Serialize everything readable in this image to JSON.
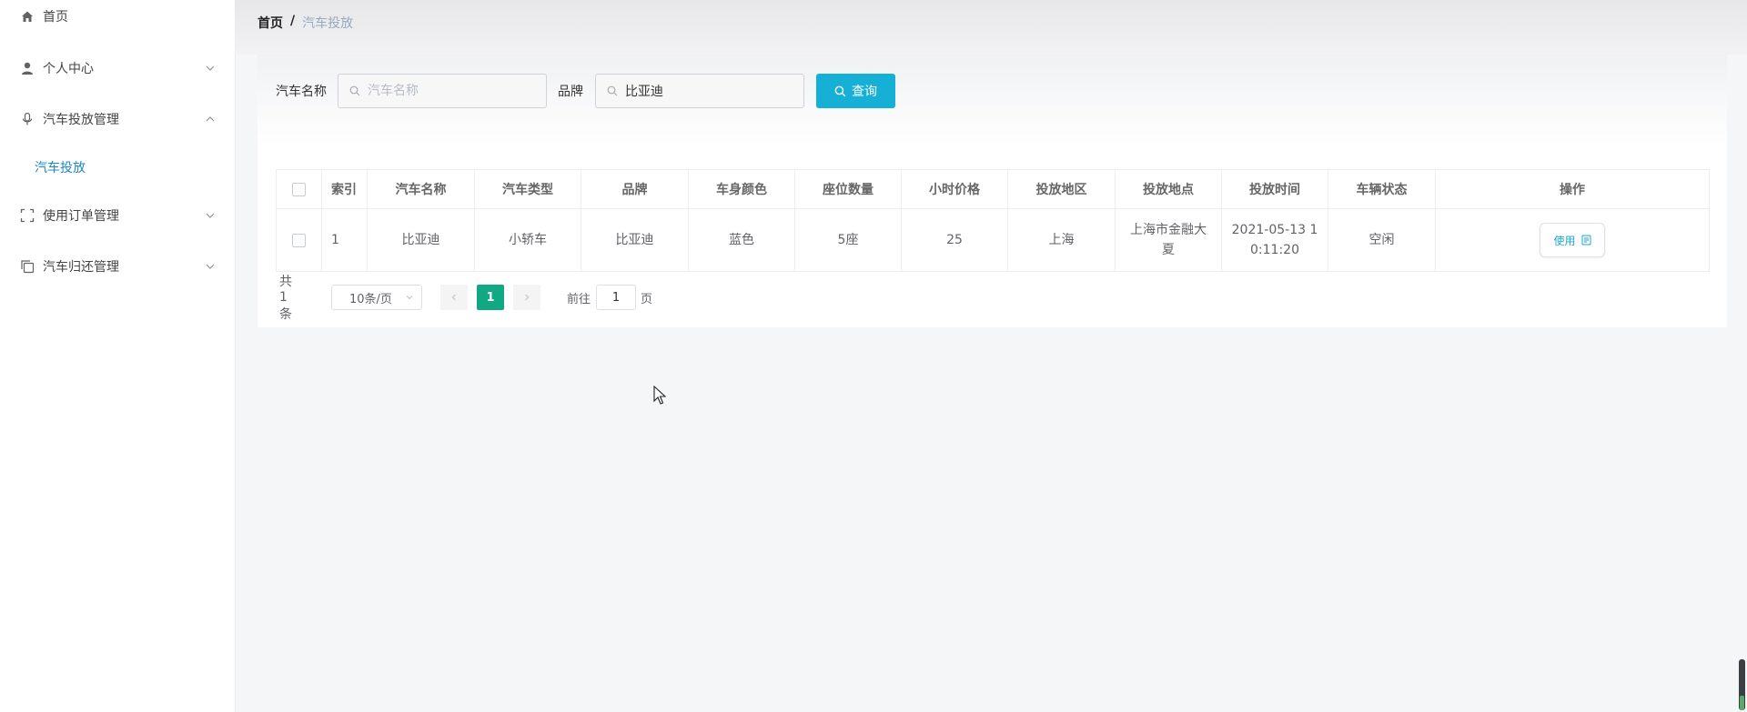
{
  "sidebar": {
    "items": [
      {
        "label": "首页",
        "icon": "home-icon"
      },
      {
        "label": "个人中心",
        "icon": "user-icon"
      },
      {
        "label": "汽车投放管理",
        "icon": "microphone-icon",
        "expanded": true,
        "children": [
          {
            "label": "汽车投放",
            "active": true
          }
        ]
      },
      {
        "label": "使用订单管理",
        "icon": "scan-icon"
      },
      {
        "label": "汽车归还管理",
        "icon": "copy-icon"
      }
    ]
  },
  "breadcrumb": {
    "home": "首页",
    "sep": "/",
    "current": "汽车投放"
  },
  "search": {
    "name_label": "汽车名称",
    "name_placeholder": "汽车名称",
    "name_value": "",
    "brand_label": "品牌",
    "brand_value": "比亚迪",
    "query_label": "查询"
  },
  "table": {
    "headers": [
      "索引",
      "汽车名称",
      "汽车类型",
      "品牌",
      "车身颜色",
      "座位数量",
      "小时价格",
      "投放地区",
      "投放地点",
      "投放时间",
      "车辆状态",
      "操作"
    ],
    "rows": [
      {
        "index": "1",
        "name": "比亚迪",
        "type": "小轿车",
        "brand": "比亚迪",
        "color": "蓝色",
        "seats": "5座",
        "price": "25",
        "region": "上海",
        "location": "上海市金融大夏",
        "time": "2021-05-13 10:11:20",
        "status": "空闲",
        "action": "使用"
      }
    ]
  },
  "pagination": {
    "total": "共 1 条",
    "page_size": "10条/页",
    "current_page": "1",
    "goto_label": "前往",
    "goto_value": "1",
    "page_suffix": "页"
  },
  "colors": {
    "accent": "#16b0d6",
    "active_page": "#11a983",
    "link": "#1e88c8"
  }
}
